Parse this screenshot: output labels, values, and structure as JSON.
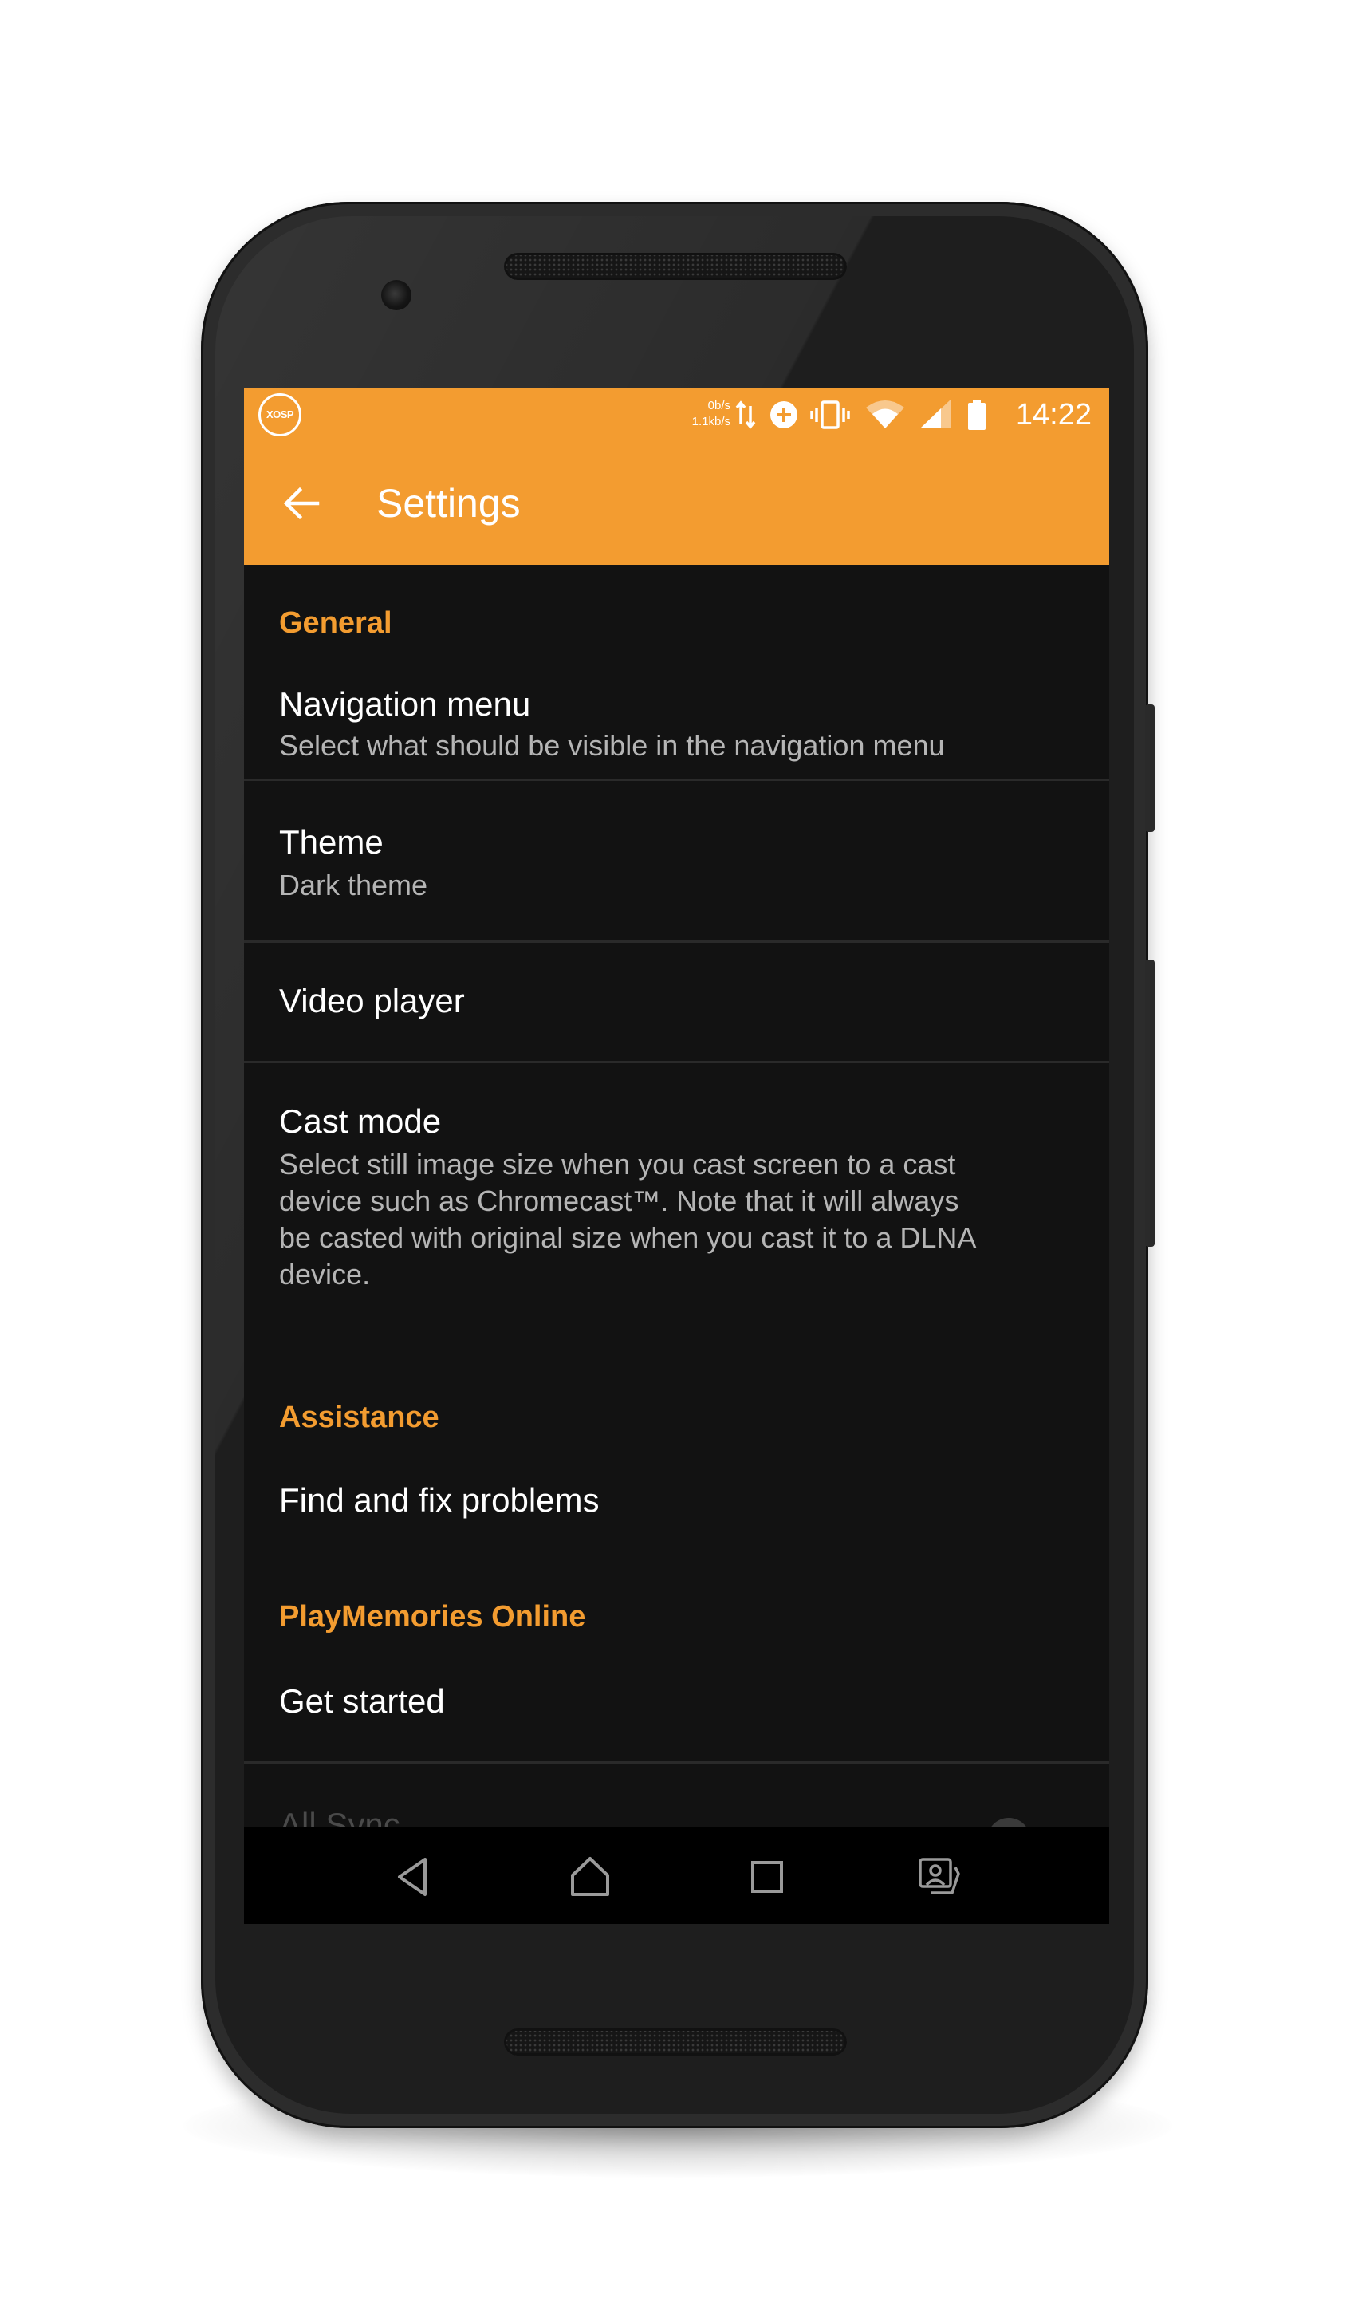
{
  "status_bar": {
    "logo_text": "XOSP",
    "upload_speed": "0b/s",
    "download_speed": "1.1kb/s",
    "time": "14:22",
    "icons": [
      "data-transfer-icon",
      "add-circle-icon",
      "vibrate-icon",
      "wifi-icon",
      "cell-signal-icon",
      "battery-icon"
    ]
  },
  "app_bar": {
    "title": "Settings",
    "back_icon": "arrow-back-icon"
  },
  "sections": {
    "general": "General",
    "assistance": "Assistance",
    "playmemories": "PlayMemories Online"
  },
  "prefs": {
    "navigation_menu": {
      "title": "Navigation menu",
      "summary": "Select what should be visible in the navigation menu"
    },
    "theme": {
      "title": "Theme",
      "summary": "Dark theme"
    },
    "video_player": {
      "title": "Video player"
    },
    "cast_mode": {
      "title": "Cast mode",
      "summary_lines": [
        "Select still image size when you cast screen to a cast",
        "device such as Chromecast™. Note that it will always",
        "be casted with original size when you cast it to a DLNA",
        "device."
      ]
    },
    "find_fix": {
      "title": "Find and fix problems"
    },
    "get_started": {
      "title": "Get started"
    },
    "all_sync": {
      "title": "All Sync"
    }
  },
  "nav_bar": {
    "icons": [
      "nav-back-icon",
      "nav-home-icon",
      "nav-recents-icon",
      "nav-screenshot-icon"
    ]
  },
  "colors": {
    "accent": "#f39c30",
    "background": "#121212",
    "primary_text": "#ffffff",
    "secondary_text": "#b5b5b5"
  }
}
